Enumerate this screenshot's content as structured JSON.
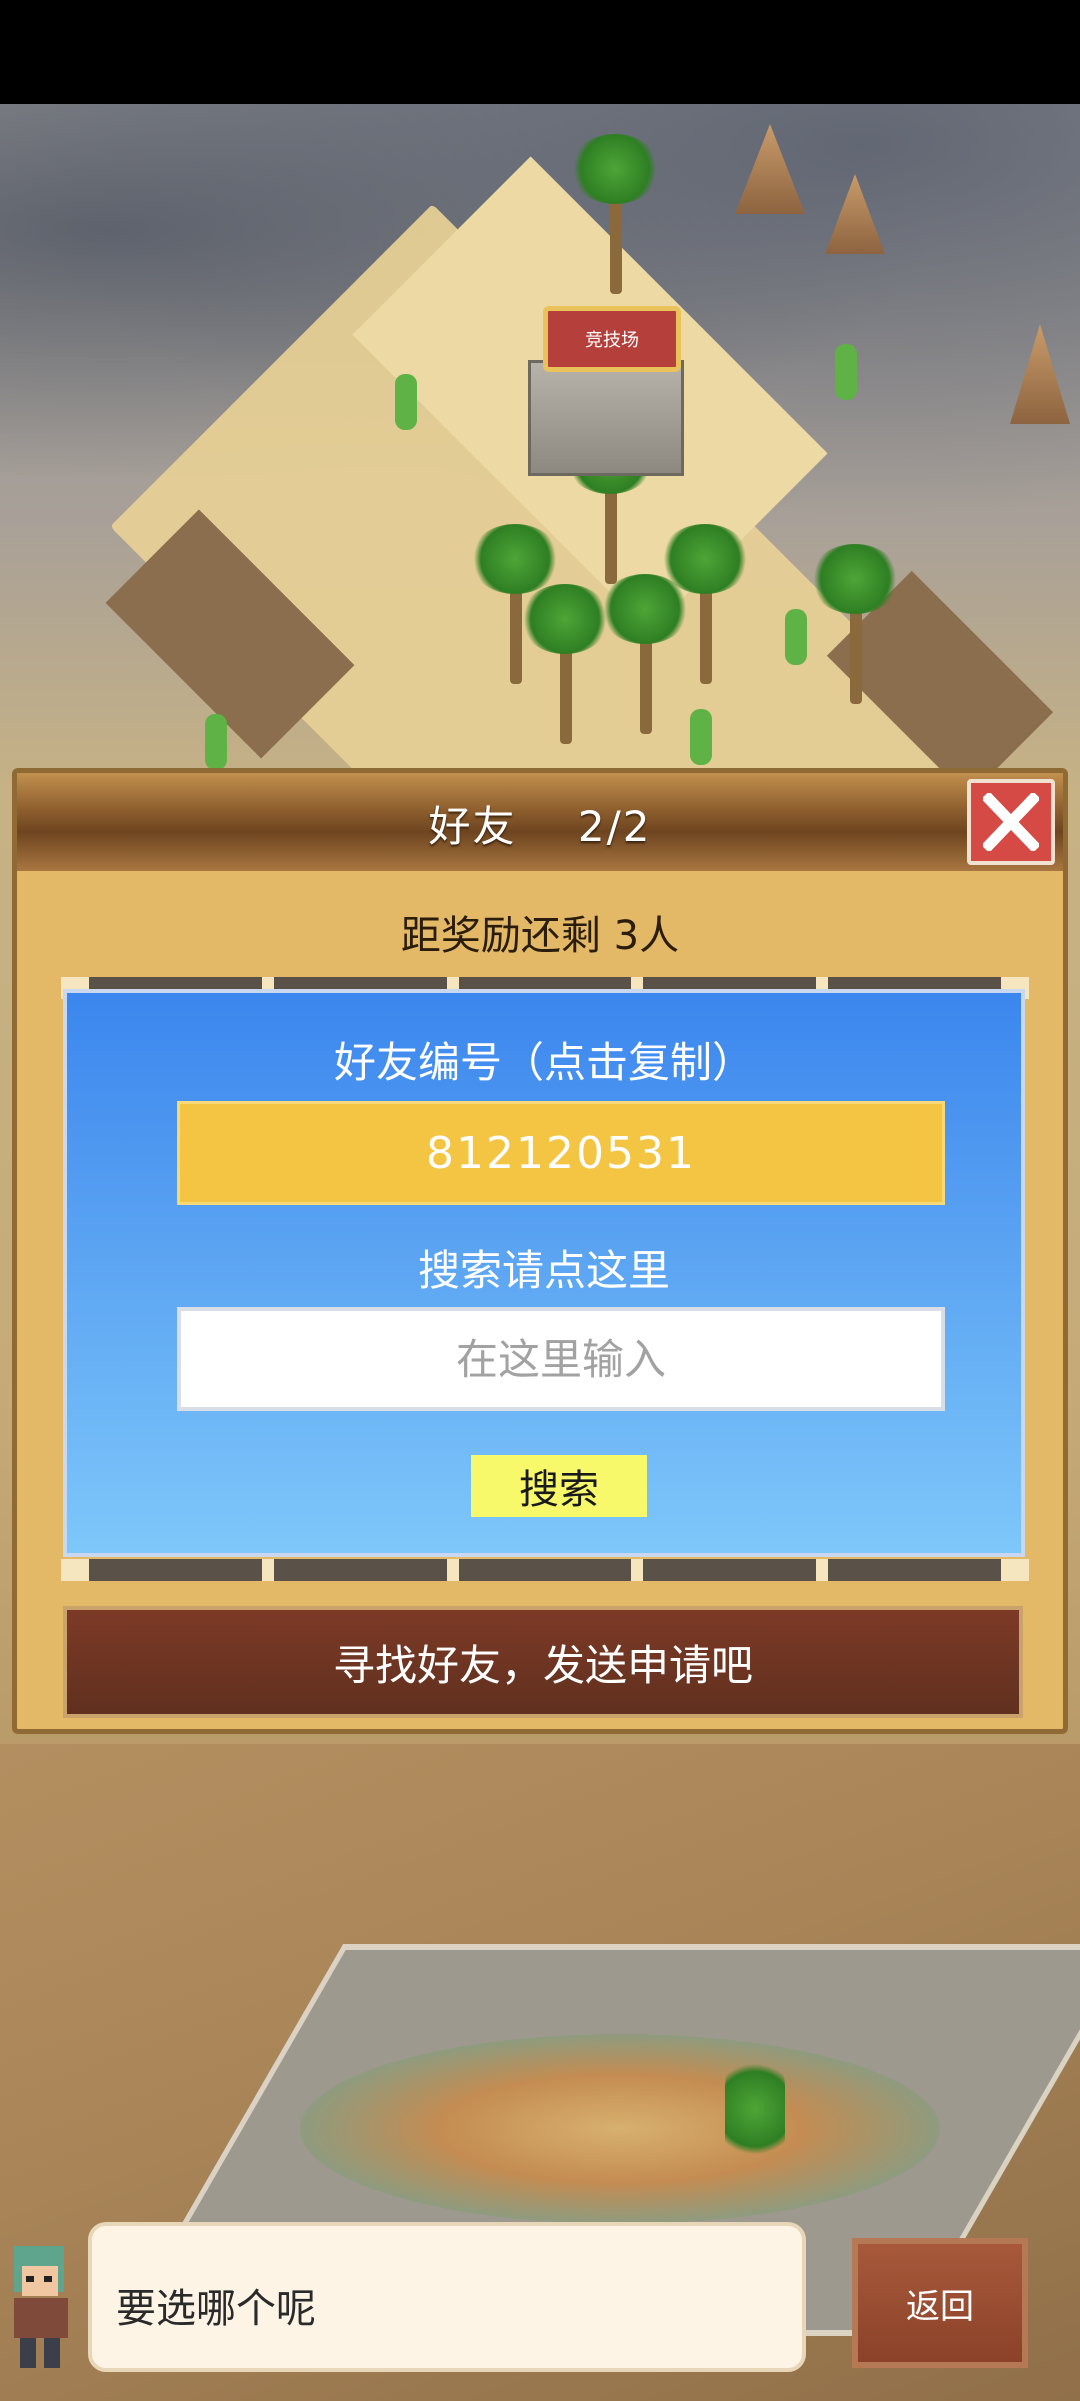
{
  "map": {
    "arena_label": "竞技场"
  },
  "dialog": {
    "title": "好友    2/2",
    "reward_text": "距奖励还剩 3人",
    "id_label": "好友编号（点击复制）",
    "friend_id": "812120531",
    "search_label": "搜索请点这里",
    "search_placeholder": "在这里输入",
    "search_button": "搜索",
    "find_friends_button": "寻找好友，发送申请吧"
  },
  "bottom": {
    "speech_text": "要选哪个呢",
    "back_button": "返回"
  },
  "colors": {
    "panel_blue": "#3b86ee",
    "id_field_yellow": "#f3c542",
    "close_red": "#d54a45",
    "search_button_yellow": "#f7f86a"
  },
  "icons": [
    "close-icon",
    "left-arrow-icon",
    "right-arrow-icon",
    "character-avatar"
  ]
}
